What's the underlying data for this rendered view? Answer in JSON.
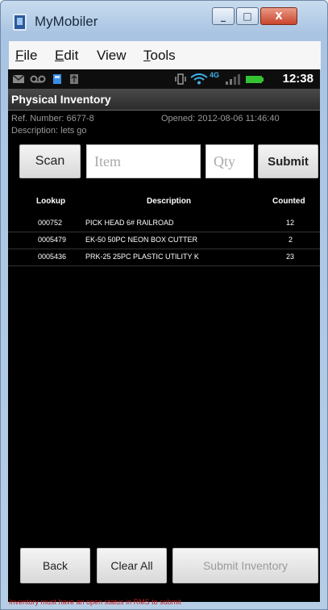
{
  "window": {
    "title": "MyMobiler",
    "controls": {
      "minimize": "_",
      "maximize": "□",
      "close": "X"
    }
  },
  "menu": {
    "items": [
      {
        "label": "File",
        "underline": "F",
        "rest": "ile"
      },
      {
        "label": "Edit",
        "underline": "E",
        "rest": "dit"
      },
      {
        "label": "View",
        "underline": "",
        "rest": "View"
      },
      {
        "label": "Tools",
        "underline": "T",
        "rest": "ools"
      }
    ]
  },
  "statusbar": {
    "time": "12:38",
    "network": "4G",
    "icons": [
      "mail-icon",
      "voicemail-icon",
      "battery-saver-icon",
      "usb-icon",
      "vibrate-icon",
      "wifi-icon",
      "signal-icon",
      "battery-icon"
    ]
  },
  "app": {
    "title": "Physical Inventory",
    "ref_number": "Ref. Number: 6677-8",
    "opened": "Opened: 2012-08-06 11:46:40",
    "description": "Description: lets go"
  },
  "entry": {
    "scan_label": "Scan",
    "item_placeholder": "Item",
    "qty_placeholder": "Qty",
    "submit_label": "Submit"
  },
  "table": {
    "headers": [
      "Lookup",
      "Description",
      "Counted"
    ],
    "rows": [
      {
        "lookup": "000752",
        "description": "PICK HEAD 6# RAILROAD",
        "counted": "12"
      },
      {
        "lookup": "0005479",
        "description": "EK-50 50PC NEON BOX CUTTER",
        "counted": "2"
      },
      {
        "lookup": "0005436",
        "description": "PRK-25  25PC PLASTIC UTILITY K",
        "counted": "23"
      }
    ]
  },
  "footer": {
    "back_label": "Back",
    "clear_label": "Clear All",
    "submit_inventory_label": "Submit Inventory",
    "warning": "Inventory must have an open status in RMS to submit"
  },
  "colors": {
    "screen_bg": "#000000",
    "warning": "#c61f1f",
    "battery": "#35c235"
  }
}
